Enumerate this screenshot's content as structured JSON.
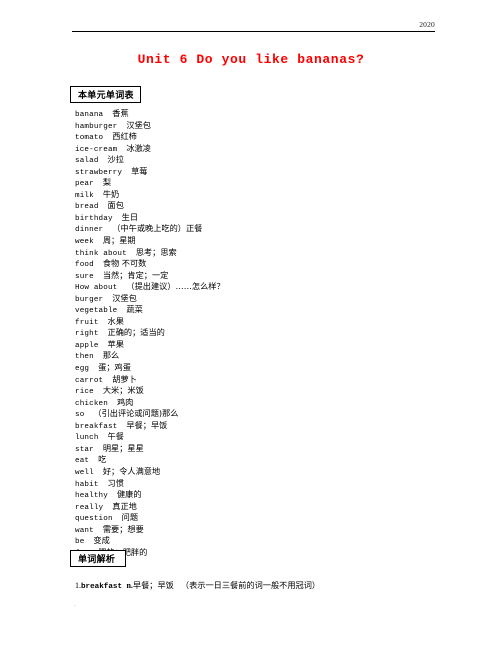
{
  "header": {
    "year": "2020"
  },
  "title": "Unit 6 Do you like bananas?",
  "sections": {
    "vocabulary_heading": "本单元单词表",
    "analysis_heading": "单词解析"
  },
  "vocabulary": [
    {
      "en": "banana",
      "cn": "香蕉"
    },
    {
      "en": "hamburger",
      "cn": "汉堡包"
    },
    {
      "en": "tomato",
      "cn": "西红柿"
    },
    {
      "en": "ice-cream",
      "cn": "冰激凌"
    },
    {
      "en": "salad",
      "cn": "沙拉"
    },
    {
      "en": "strawberry",
      "cn": "草莓"
    },
    {
      "en": "pear",
      "cn": "梨"
    },
    {
      "en": "milk",
      "cn": "牛奶"
    },
    {
      "en": "bread",
      "cn": "面包"
    },
    {
      "en": "birthday",
      "cn": "生日"
    },
    {
      "en": "dinner",
      "cn": "（中午或晚上吃的）正餐"
    },
    {
      "en": "week",
      "cn": "周；星期"
    },
    {
      "en": "think about",
      "cn": "思考；思索"
    },
    {
      "en": "food",
      "cn": "食物  不可数"
    },
    {
      "en": "sure",
      "cn": "当然；肯定；一定"
    },
    {
      "en": "How about",
      "cn": "（提出建议）……怎么样？"
    },
    {
      "en": "burger",
      "cn": "汉堡包"
    },
    {
      "en": "vegetable",
      "cn": "蔬菜"
    },
    {
      "en": "fruit",
      "cn": "水果"
    },
    {
      "en": "right",
      "cn": "正确的；适当的"
    },
    {
      "en": "apple",
      "cn": "苹果"
    },
    {
      "en": "then",
      "cn": "那么"
    },
    {
      "en": "egg",
      "cn": "蛋；鸡蛋"
    },
    {
      "en": "carrot",
      "cn": "胡萝卜"
    },
    {
      "en": "rice",
      "cn": "大米；米饭"
    },
    {
      "en": "chicken",
      "cn": "鸡肉"
    },
    {
      "en": "so",
      "cn": "（引出评论或问题)那么"
    },
    {
      "en": "breakfast",
      "cn": "早餐；早饭"
    },
    {
      "en": "lunch",
      "cn": "午餐"
    },
    {
      "en": "star",
      "cn": "明星；星星"
    },
    {
      "en": "eat",
      "cn": "吃"
    },
    {
      "en": "well",
      "cn": "好；令人满意地"
    },
    {
      "en": "habit",
      "cn": "习惯"
    },
    {
      "en": "healthy",
      "cn": "健康的"
    },
    {
      "en": "really",
      "cn": "真正地"
    },
    {
      "en": "question",
      "cn": "问题"
    },
    {
      "en": "want",
      "cn": "需要；想要"
    },
    {
      "en": "be",
      "cn": "变成"
    },
    {
      "en": "fat",
      "cn": "肥的；肥胖的"
    }
  ],
  "analysis": [
    {
      "num": "1.",
      "en": "breakfast",
      "pos": "n.",
      "cn": "早餐；早饭",
      "note": "（表示一日三餐前的词一般不用冠词）"
    }
  ],
  "footer_mark": "."
}
